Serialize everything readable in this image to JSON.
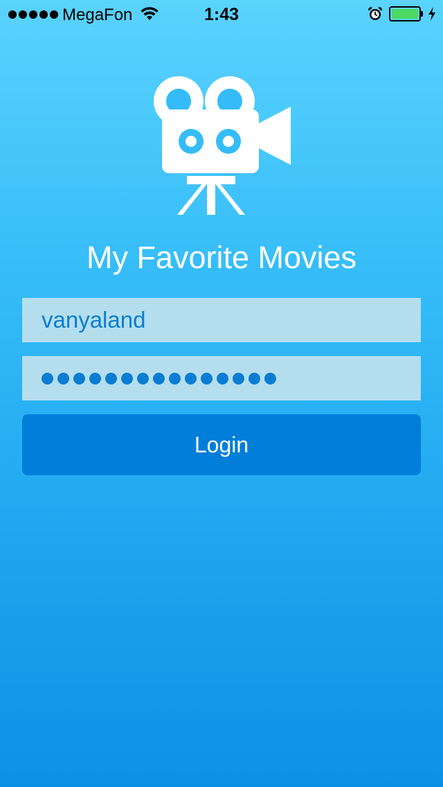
{
  "status_bar": {
    "signal_dots": 5,
    "carrier": "MegaFon",
    "time": "1:43",
    "battery_color": "#4CD964"
  },
  "logo": {
    "icon": "movie-camera-icon"
  },
  "app": {
    "title": "My Favorite Movies"
  },
  "login_form": {
    "username_value": "vanyaland",
    "password_length": 15,
    "login_label": "Login"
  },
  "colors": {
    "field_background": "#B4DEEE",
    "field_text": "#0A7DD2",
    "button_background": "#007ED9",
    "gradient_top": "#5AD3FD",
    "gradient_bottom": "#0A91E6"
  }
}
